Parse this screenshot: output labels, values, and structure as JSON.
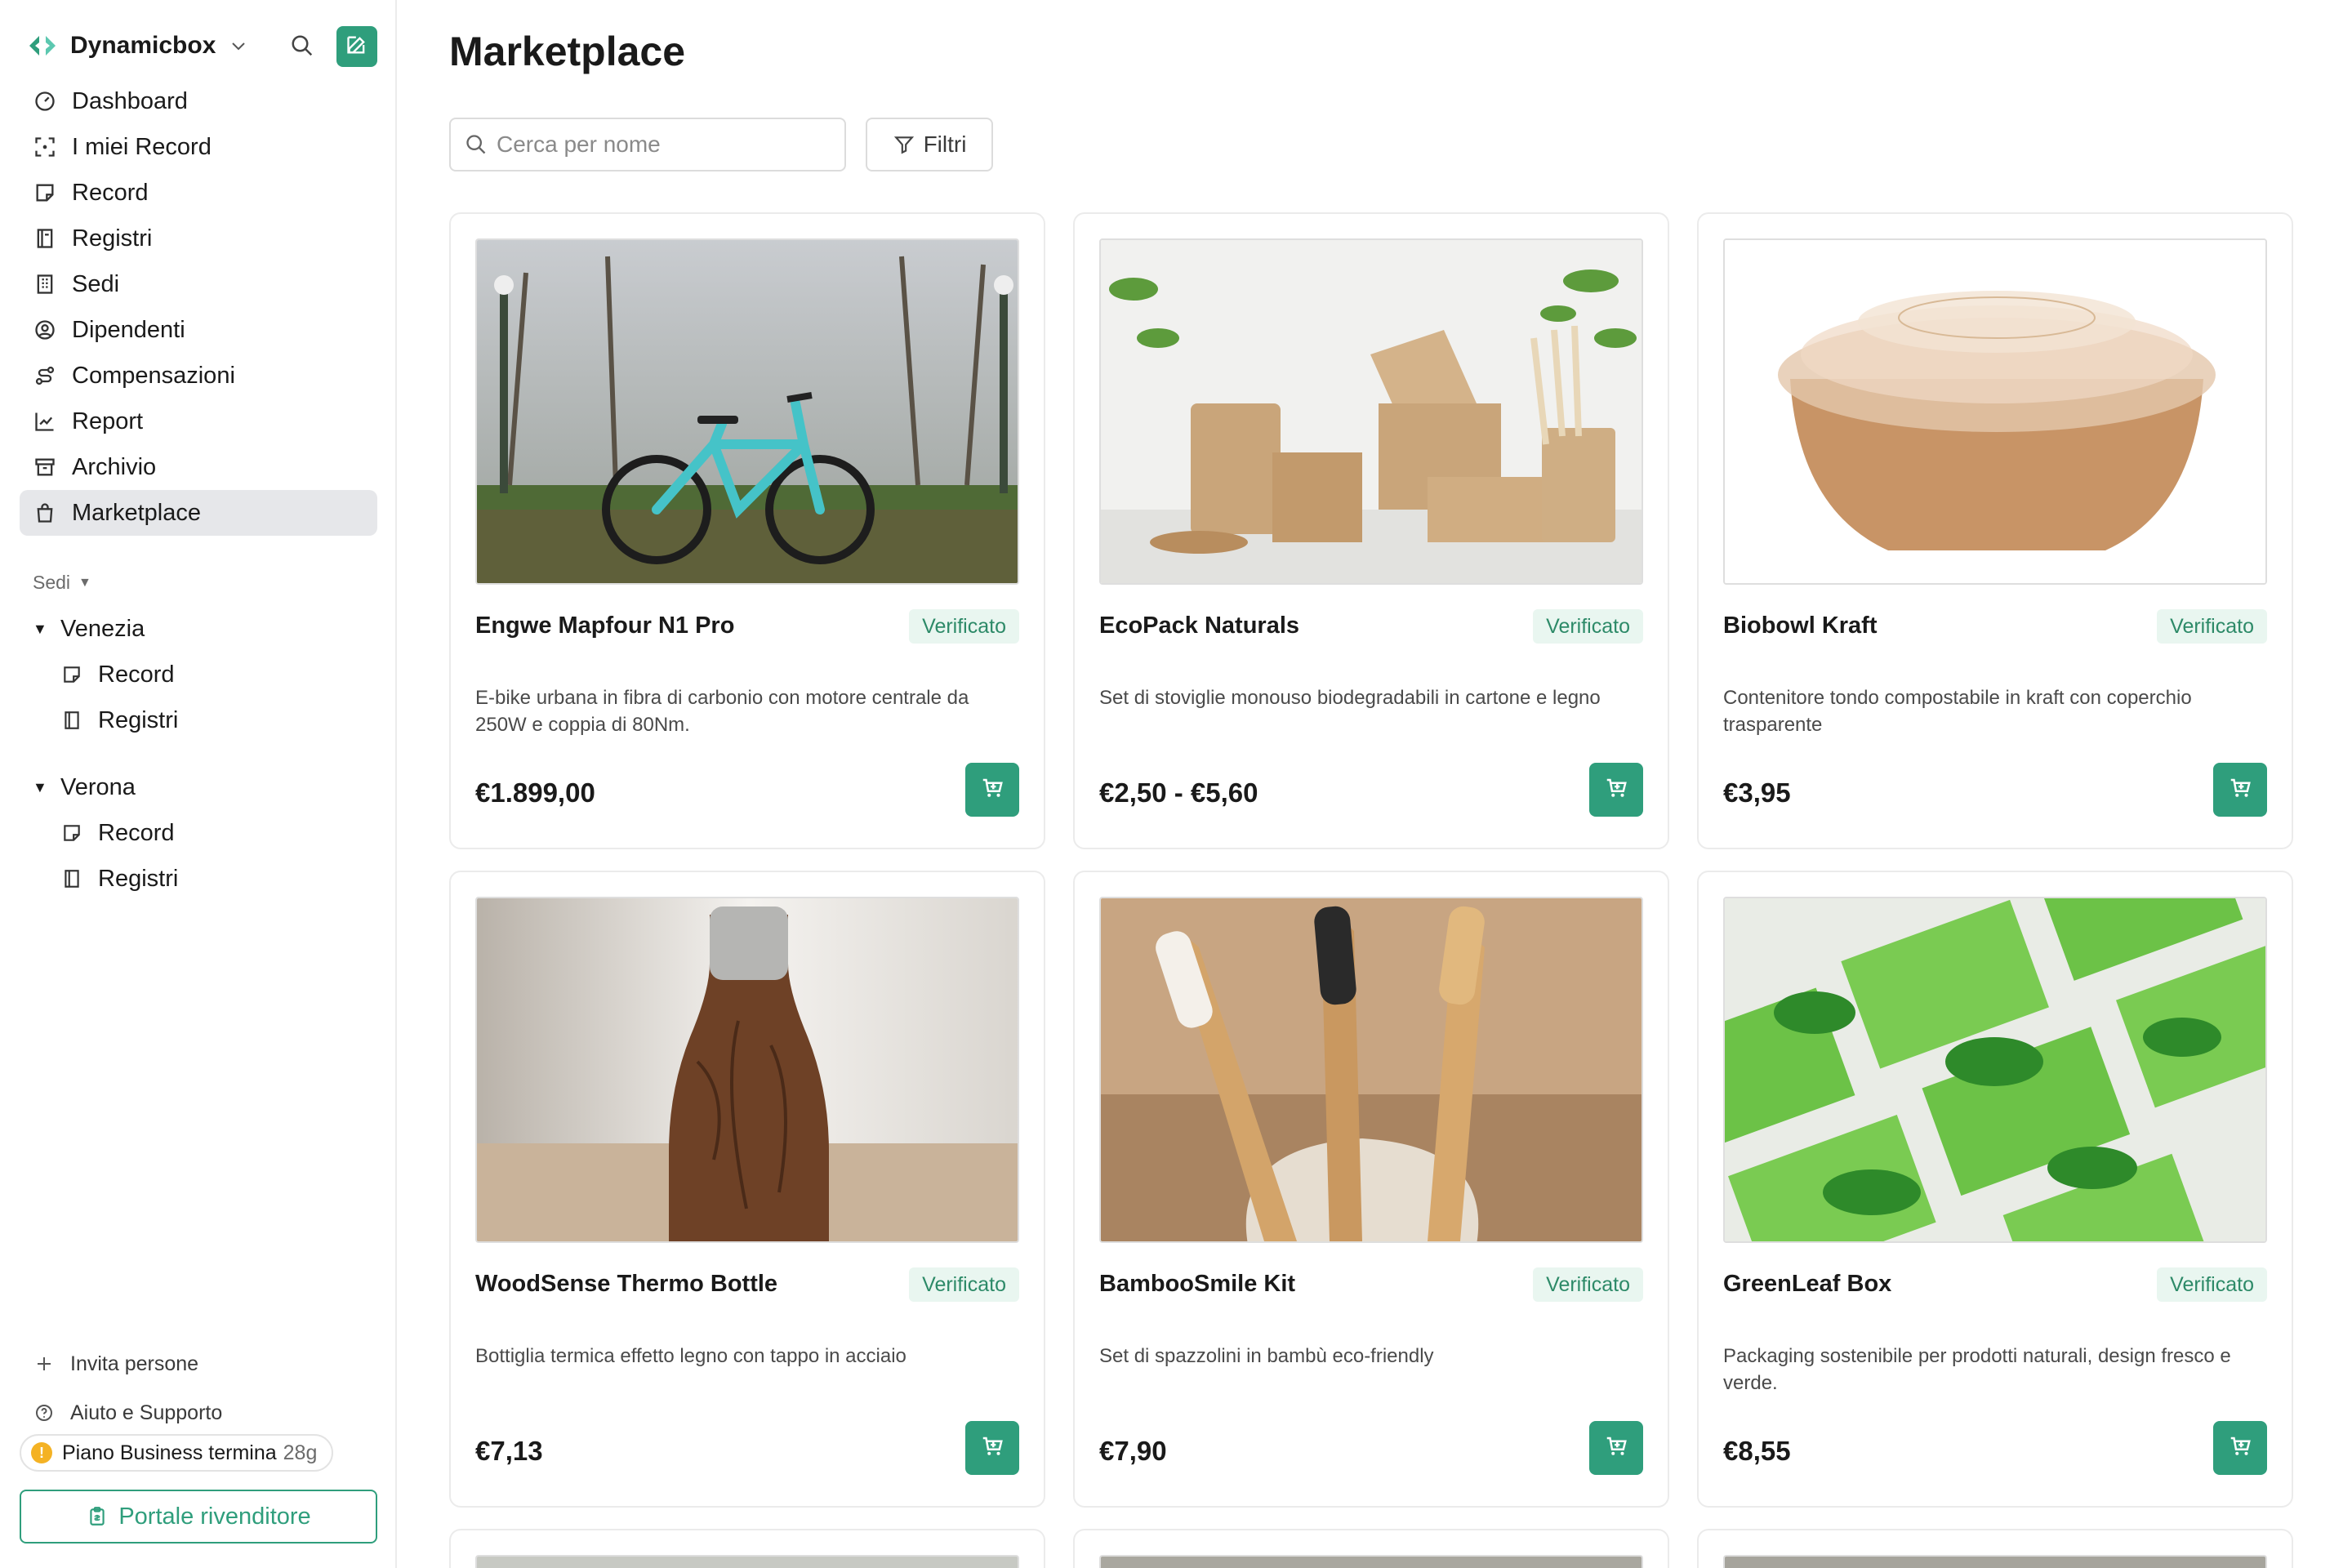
{
  "app": {
    "workspace_name": "Dynamicbox",
    "brand_color": "#2f9e7c"
  },
  "sidebar": {
    "nav": [
      {
        "label": "Dashboard",
        "icon": "dashboard-icon"
      },
      {
        "label": "I miei Record",
        "icon": "scan-icon"
      },
      {
        "label": "Record",
        "icon": "note-icon"
      },
      {
        "label": "Registri",
        "icon": "book-icon"
      },
      {
        "label": "Sedi",
        "icon": "building-icon"
      },
      {
        "label": "Dipendenti",
        "icon": "user-circle-icon"
      },
      {
        "label": "Compensazioni",
        "icon": "route-icon"
      },
      {
        "label": "Report",
        "icon": "chart-icon"
      },
      {
        "label": "Archivio",
        "icon": "archive-icon"
      },
      {
        "label": "Marketplace",
        "icon": "shopping-bag-icon",
        "active": true
      }
    ],
    "section_label": "Sedi",
    "locations": [
      {
        "name": "Venezia",
        "items": [
          {
            "label": "Record"
          },
          {
            "label": "Registri"
          }
        ]
      },
      {
        "name": "Verona",
        "items": [
          {
            "label": "Record"
          },
          {
            "label": "Registri"
          }
        ]
      }
    ],
    "footer": {
      "invite_label": "Invita persone",
      "help_label": "Aiuto e Supporto",
      "plan_label": "Piano Business termina",
      "plan_days": "28g",
      "plan_alert": "!",
      "reseller_label": "Portale rivenditore"
    }
  },
  "main": {
    "title": "Marketplace",
    "search_placeholder": "Cerca per nome",
    "filter_label": "Filtri",
    "products": [
      {
        "name": "Engwe Mapfour N1 Pro",
        "badge": "Verificato",
        "description": "E-bike urbana in fibra di carbonio con motore centrale da 250W e coppia di 80Nm.",
        "price": "€1.899,00",
        "image": "bike-photo"
      },
      {
        "name": "EcoPack Naturals",
        "badge": "Verificato",
        "description": "Set di stoviglie monouso biodegradabili in cartone e legno",
        "price": "€2,50 - €5,60",
        "image": "packaging-photo"
      },
      {
        "name": "Biobowl Kraft",
        "badge": "Verificato",
        "description": "Contenitore tondo compostabile in kraft con coperchio trasparente",
        "price": "€3,95",
        "image": "bowl-photo"
      },
      {
        "name": "WoodSense Thermo Bottle",
        "badge": "Verificato",
        "description": "Bottiglia termica effetto legno con tappo in acciaio",
        "price": "€7,13",
        "image": "bottle-photo"
      },
      {
        "name": "BambooSmile Kit",
        "badge": "Verificato",
        "description": "Set di spazzolini in bambù eco-friendly",
        "price": "€7,90",
        "image": "toothbrush-photo"
      },
      {
        "name": "GreenLeaf Box",
        "badge": "Verificato",
        "description": "Packaging sostenibile per prodotti naturali, design fresco e verde.",
        "price": "€8,55",
        "image": "greenbox-photo"
      }
    ]
  }
}
